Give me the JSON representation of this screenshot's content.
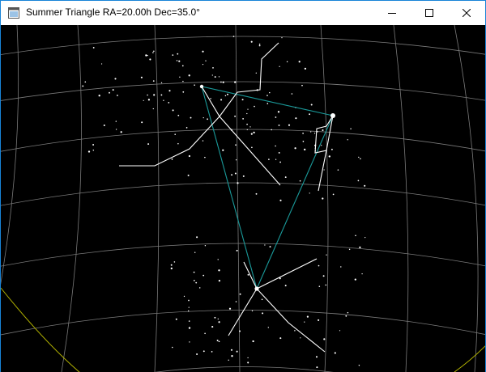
{
  "window": {
    "title": "Summer Triangle RA=20.00h Dec=35.0°",
    "icon": "app-window-icon",
    "buttons": [
      {
        "name": "minimize-button",
        "icon": "minimize-icon"
      },
      {
        "name": "maximize-button",
        "icon": "maximize-icon"
      },
      {
        "name": "close-button",
        "icon": "close-icon"
      }
    ]
  },
  "sky": {
    "background_color": "#000000",
    "grid_color": "#7a7a7a",
    "constellation_line_color": "#ffffff",
    "asterism_line_color": "#1a9a9a",
    "horizon_color": "#b0b000"
  }
}
